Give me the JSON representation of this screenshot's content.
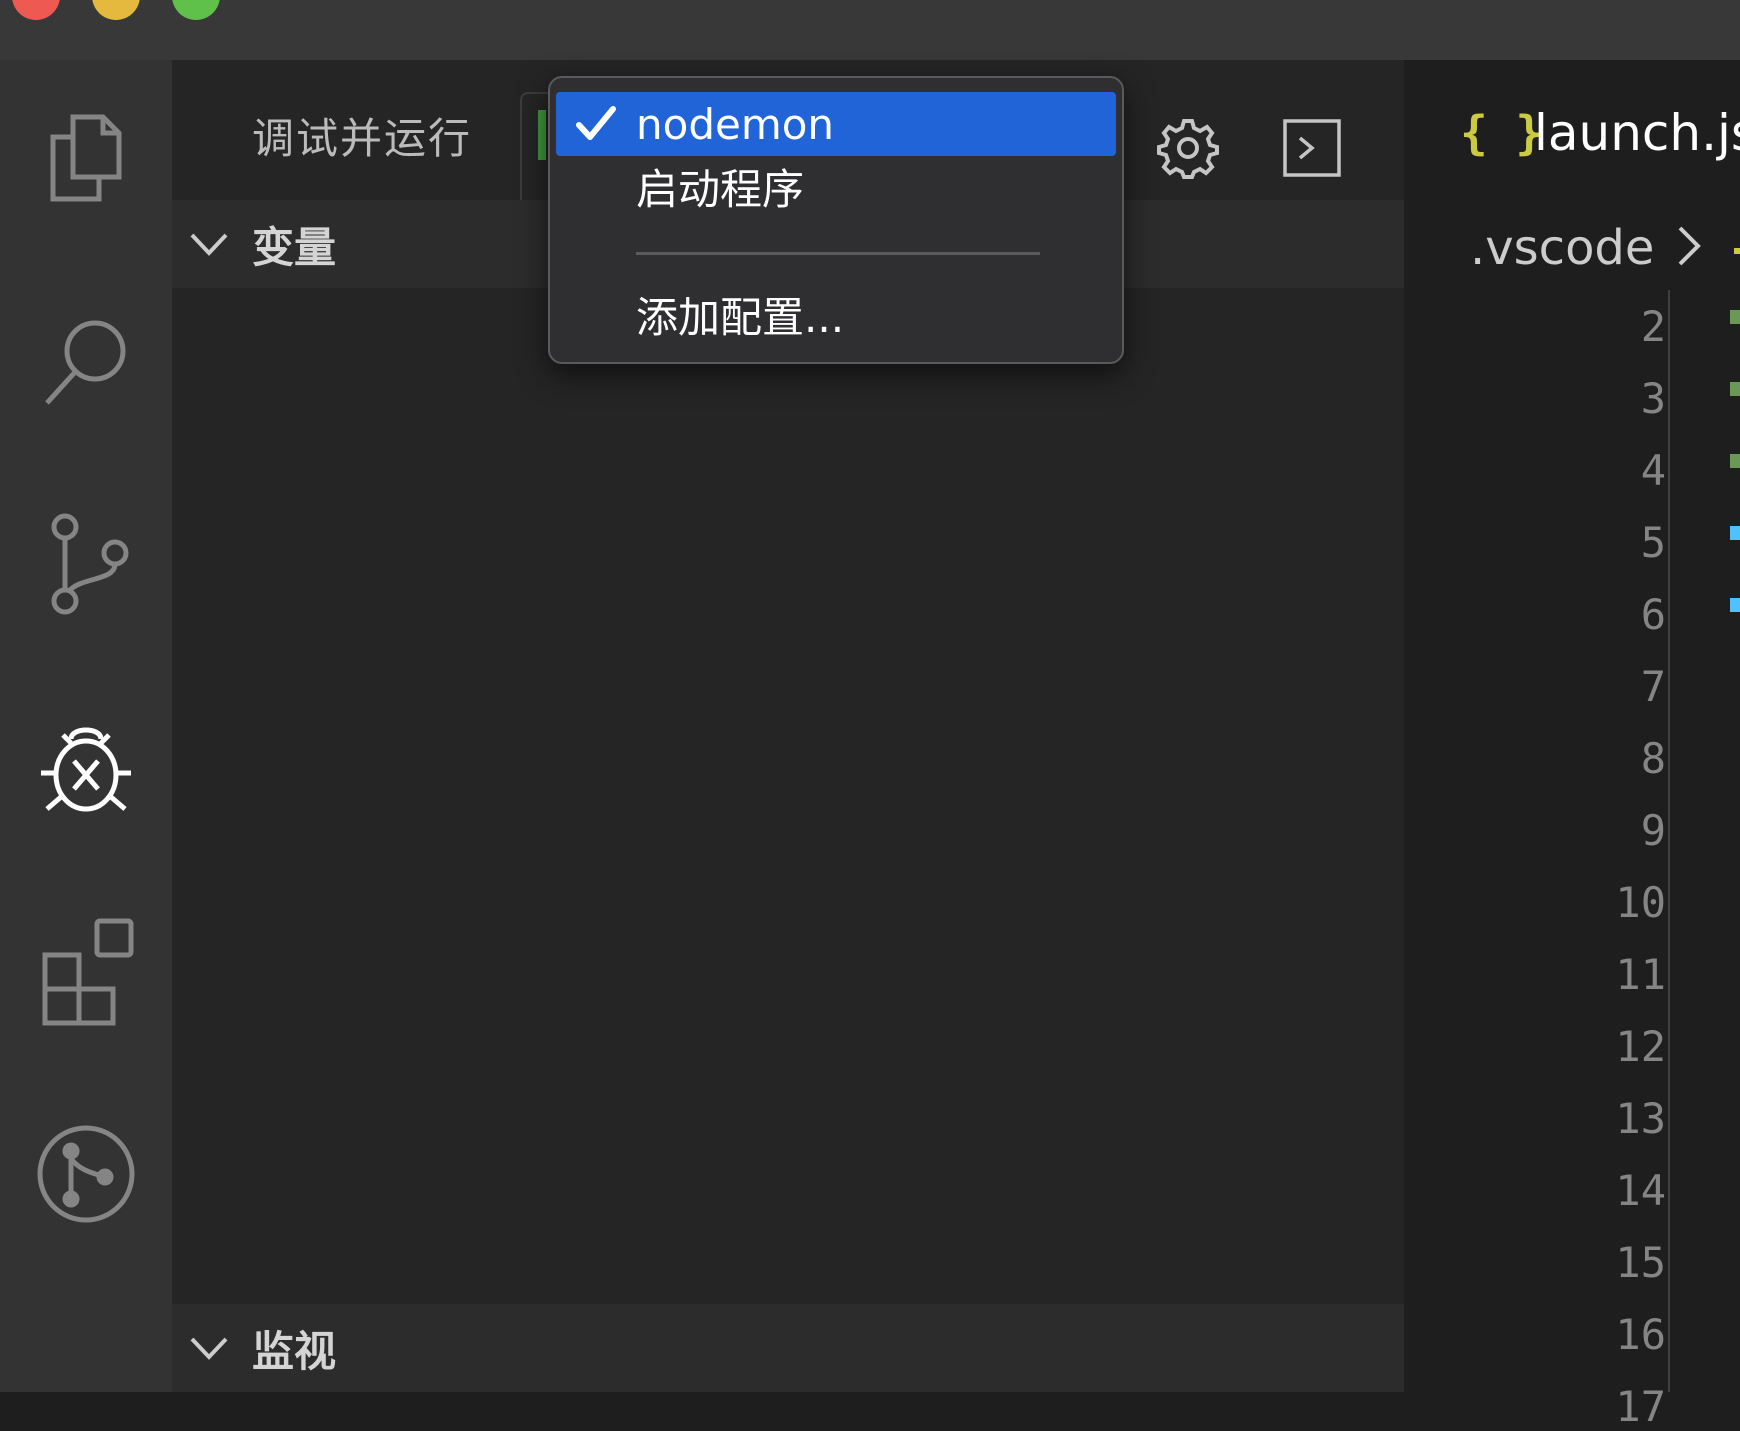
{
  "debug_panel": {
    "title": "调试并运行",
    "sections": {
      "variables": "变量",
      "watch": "监视"
    }
  },
  "config_dropdown": {
    "items": [
      {
        "label": "nodemon",
        "selected": true
      },
      {
        "label": "启动程序",
        "selected": false
      },
      {
        "label": "添加配置...",
        "selected": false
      }
    ]
  },
  "editor": {
    "tab_label": "launch.js",
    "tab_icon": "{ }",
    "breadcrumb": ".vscode",
    "line_numbers": [
      "2",
      "3",
      "4",
      "5",
      "6",
      "7",
      "8",
      "9",
      "10",
      "11",
      "12",
      "13",
      "14",
      "15",
      "16",
      "17"
    ]
  },
  "colors": {
    "accent": "#2164d8",
    "json_icon": "#cbcb41",
    "run_green": "#3f9a3f",
    "code_blue": "#4fc1ff",
    "code_green": "#6a9955"
  },
  "icons": {
    "activity": [
      "files-icon",
      "search-icon",
      "source-control-icon",
      "run-debug-icon",
      "extensions-icon",
      "git-graph-icon"
    ],
    "toolbar": [
      "gear-icon",
      "terminal-icon"
    ]
  }
}
